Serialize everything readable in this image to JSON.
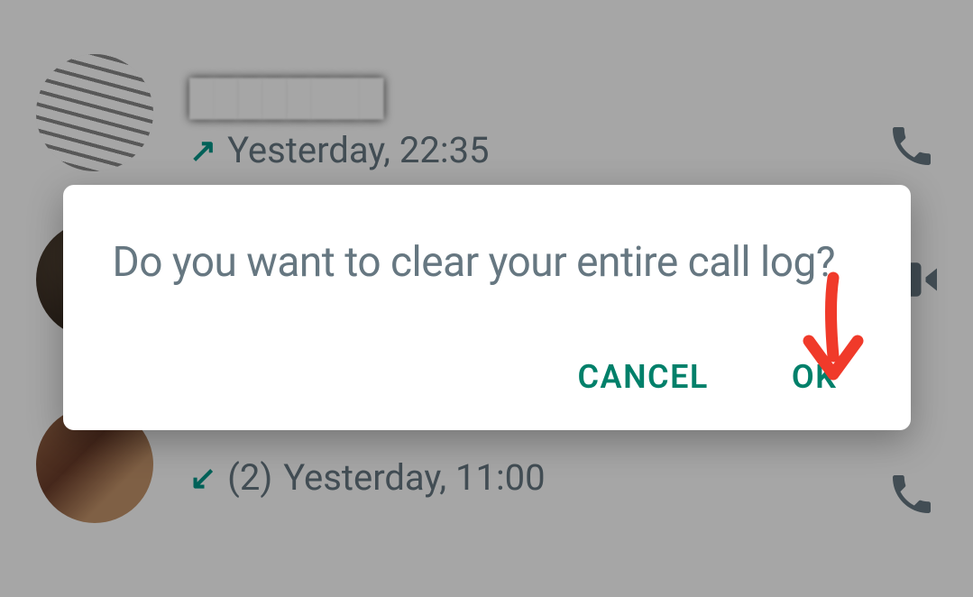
{
  "calls": [
    {
      "name_redacted": true,
      "direction": "outgoing",
      "time_label": "Yesterday, 22:35",
      "call_type": "voice"
    },
    {
      "name_redacted": true,
      "direction": "unknown",
      "time_label": "",
      "call_type": "video"
    },
    {
      "name_redacted": true,
      "direction": "incoming",
      "count_label": "(2)",
      "time_label": "Yesterday, 11:00",
      "call_type": "voice"
    }
  ],
  "dialog": {
    "message": "Do you want to clear your entire call log?",
    "cancel_label": "CANCEL",
    "ok_label": "OK"
  },
  "colors": {
    "accent": "#00806a",
    "arrow": "#009688",
    "text_secondary": "#667781",
    "annotation": "#f03a2a"
  }
}
